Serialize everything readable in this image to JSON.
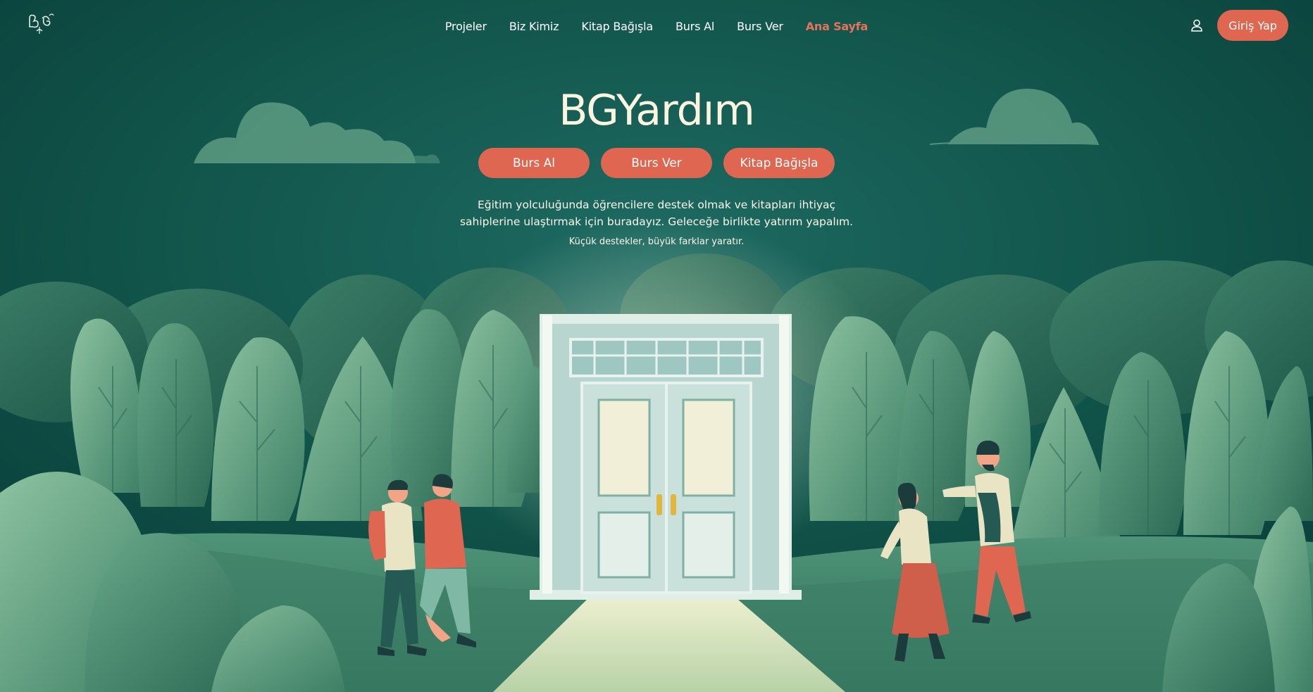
{
  "brand": {
    "logo_icon": "bg-logo-icon"
  },
  "nav": {
    "items": [
      {
        "label": "Projeler",
        "active": false
      },
      {
        "label": "Biz Kimiz",
        "active": false
      },
      {
        "label": "Kitap Bağışla",
        "active": false
      },
      {
        "label": "Burs Al",
        "active": false
      },
      {
        "label": "Burs Ver",
        "active": false
      },
      {
        "label": "Ana Sayfa",
        "active": true
      }
    ]
  },
  "header": {
    "user_icon": "user-icon",
    "login_label": "Giriş Yap"
  },
  "hero": {
    "title": "BGYardım",
    "buttons": [
      {
        "label": "Burs Al"
      },
      {
        "label": "Burs Ver"
      },
      {
        "label": "Kitap Bağışla"
      }
    ],
    "description_line1": "Eğitim yolculuğunda öğrencilere destek olmak ve kitapları ihtiyaç",
    "description_line2": "sahiplerine ulaştırmak için buradayız. Geleceğe birlikte yatırım yapalım.",
    "tagline": "Küçük destekler, büyük farklar yaratır."
  },
  "colors": {
    "background": "#0d4a48",
    "accent": "#df6650",
    "active_nav": "#e8715a",
    "title": "#fbf5e0"
  },
  "illustration": {
    "icon": "forest-door-illustration"
  }
}
